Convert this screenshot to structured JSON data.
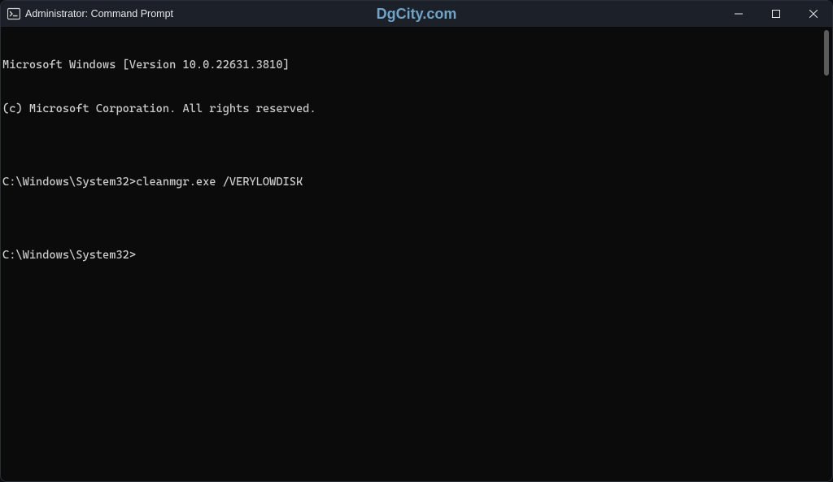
{
  "titlebar": {
    "title": "Administrator: Command Prompt",
    "watermark": "DgCity.com"
  },
  "terminal": {
    "lines": [
      "Microsoft Windows [Version 10.0.22631.3810]",
      "(c) Microsoft Corporation. All rights reserved.",
      "",
      "C:\\Windows\\System32>cleanmgr.exe /VERYLOWDISK",
      "",
      "C:\\Windows\\System32>"
    ]
  }
}
